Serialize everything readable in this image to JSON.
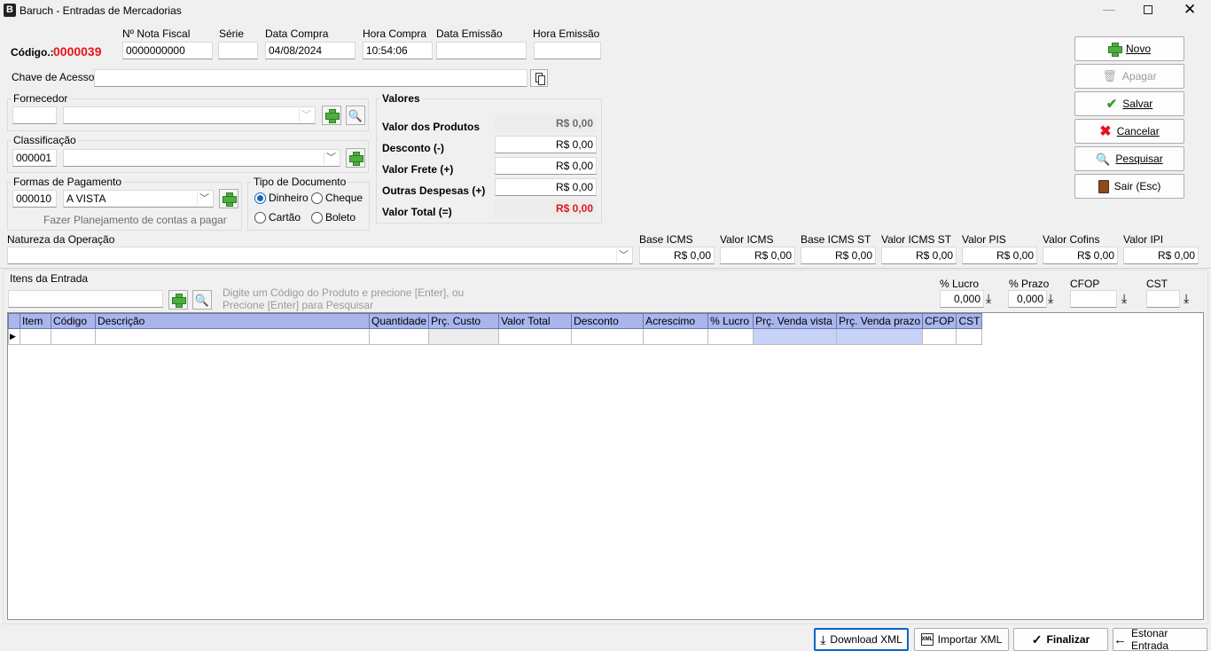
{
  "window": {
    "title": "Baruch - Entradas de Mercadorias"
  },
  "header": {
    "codigo_label": "Código.:",
    "codigo_value": "0000039",
    "nota_fiscal_label": "Nº Nota Fiscal",
    "nota_fiscal_value": "0000000000",
    "serie_label": "Série",
    "serie_value": "",
    "data_compra_label": "Data Compra",
    "data_compra_value": "04/08/2024",
    "hora_compra_label": "Hora Compra",
    "hora_compra_value": "10:54:06",
    "data_emissao_label": "Data Emissão",
    "data_emissao_value": "",
    "hora_emissao_label": "Hora Emissão",
    "hora_emissao_value": "",
    "chave_label": "Chave de Acesso:",
    "chave_value": ""
  },
  "fornecedor": {
    "label": "Fornecedor",
    "code": "",
    "name": ""
  },
  "classificacao": {
    "label": "Classificação",
    "code": "000001",
    "name": ""
  },
  "pagamento": {
    "label": "Formas de Pagamento",
    "code": "000010",
    "name": "A VISTA",
    "planejamento": "Fazer Planejamento de contas a pagar"
  },
  "tipo_documento": {
    "label": "Tipo de Documento",
    "options": [
      "Dinheiro",
      "Cheque",
      "Cartão",
      "Boleto"
    ],
    "selected": "Dinheiro"
  },
  "valores": {
    "label": "Valores",
    "produtos_label": "Valor dos Produtos",
    "produtos_value": "R$ 0,00",
    "desconto_label": "Desconto (-)",
    "desconto_value": "R$ 0,00",
    "frete_label": "Valor Frete (+)",
    "frete_value": "R$ 0,00",
    "outras_label": "Outras Despesas (+)",
    "outras_value": "R$ 0,00",
    "total_label": "Valor Total (=)",
    "total_value": "R$ 0,00"
  },
  "actions": {
    "novo": "Novo",
    "apagar": "Apagar",
    "salvar": "Salvar",
    "cancelar": "Cancelar",
    "pesquisar": "Pesquisar",
    "sair": "Sair (Esc)"
  },
  "natureza": {
    "label": "Natureza da Operação",
    "value": ""
  },
  "impostos": [
    {
      "label": "Base ICMS",
      "value": "R$ 0,00"
    },
    {
      "label": "Valor ICMS",
      "value": "R$ 0,00"
    },
    {
      "label": "Base ICMS ST",
      "value": "R$ 0,00"
    },
    {
      "label": "Valor ICMS ST",
      "value": "R$ 0,00"
    },
    {
      "label": "Valor PIS",
      "value": "R$ 0,00"
    },
    {
      "label": "Valor Cofins",
      "value": "R$ 0,00"
    },
    {
      "label": "Valor IPI",
      "value": "R$ 0,00"
    }
  ],
  "itens": {
    "label": "Itens da Entrada",
    "hint_line1": "Digite um Código do Produto e precione [Enter], ou",
    "hint_line2": "Precione [Enter] para Pesquisar",
    "lucro_label": "% Lucro",
    "lucro_value": "0,000",
    "prazo_label": "% Prazo",
    "prazo_value": "0,000",
    "cfop_label": "CFOP",
    "cfop_value": "",
    "cst_label": "CST",
    "cst_value": "",
    "columns": [
      "Item",
      "Código",
      "Descrição",
      "Quantidade",
      "Prç. Custo",
      "Valor Total",
      "Desconto",
      "Acrescimo",
      "% Lucro",
      "Prç. Venda vista",
      "Prç. Venda prazo",
      "CFOP",
      "CST"
    ]
  },
  "footer": {
    "download_xml": "Download XML",
    "importar_xml": "Importar XML",
    "finalizar": "Finalizar",
    "estornar": "Estonar Entrada"
  },
  "colors": {
    "accent_red": "#e8141b",
    "grid_header": "#a9b6ee",
    "grid_highlight": "#c7d2f8"
  }
}
